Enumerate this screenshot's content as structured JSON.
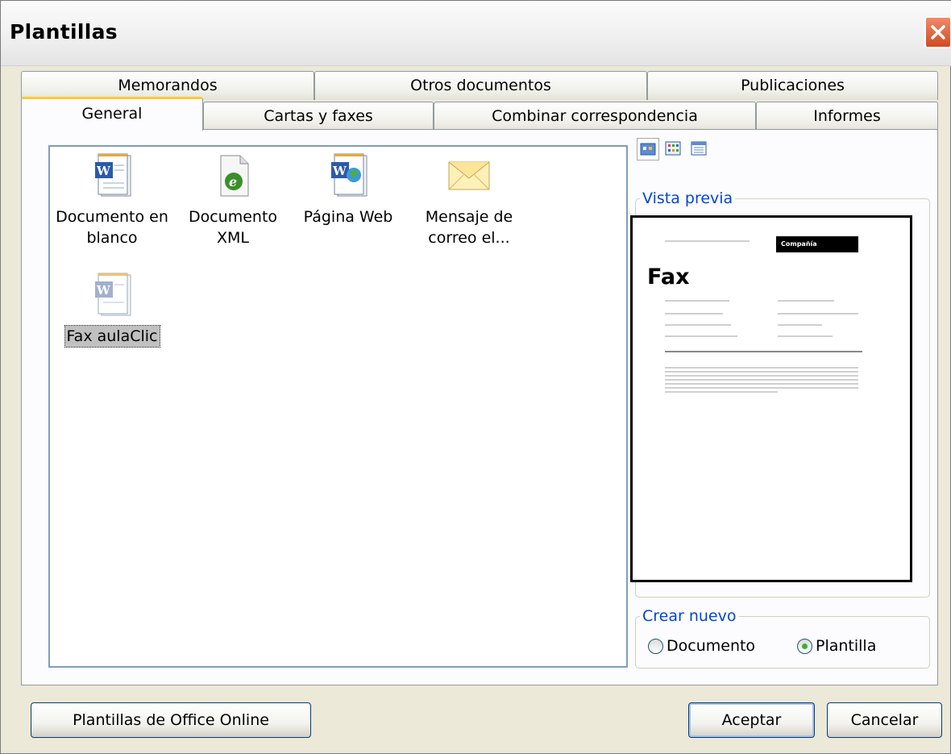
{
  "window": {
    "title": "Plantillas"
  },
  "tabs": {
    "back_row": [
      "Memorandos",
      "Otros documentos",
      "Publicaciones"
    ],
    "front_row": [
      "General",
      "Cartas y faxes",
      "Combinar correspondencia",
      "Informes"
    ],
    "active": "General"
  },
  "templates": [
    {
      "label": "Documento en blanco",
      "icon": "word-document-icon"
    },
    {
      "label": "Documento XML",
      "icon": "xml-document-icon"
    },
    {
      "label": "Página Web",
      "icon": "web-page-icon"
    },
    {
      "label": "Mensaje de correo el...",
      "icon": "email-envelope-icon"
    },
    {
      "label": "Fax aulaClic",
      "icon": "word-template-icon",
      "selected": true
    }
  ],
  "view_buttons": [
    "large-icons-view-icon",
    "list-view-icon",
    "details-view-icon"
  ],
  "preview": {
    "legend": "Vista previa",
    "company_text": "Compañía",
    "heading": "Fax"
  },
  "create_new": {
    "legend": "Crear nuevo",
    "options": [
      "Documento",
      "Plantilla"
    ],
    "selected": "Plantilla"
  },
  "buttons": {
    "online": "Plantillas de Office Online",
    "ok": "Aceptar",
    "cancel": "Cancelar"
  },
  "colors": {
    "accent_tab": "#ffc83c",
    "legend_text": "#0046d5",
    "close_button": "#d24a22"
  }
}
